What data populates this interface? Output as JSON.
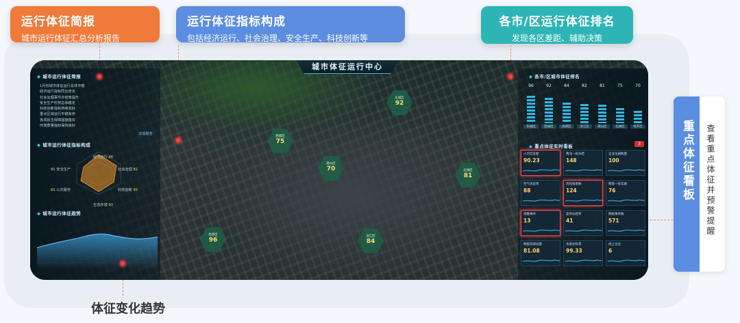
{
  "callouts": {
    "report": {
      "title": "运行体征简报",
      "subtitle": "城市运行体征汇总分析报告"
    },
    "composition": {
      "title": "运行体征指标构成",
      "subtitle": "包括经济运行、社会治理、安全生产、科技创新等"
    },
    "ranking": {
      "title": "各市/区运行体征排名",
      "subtitle": "发现各区差距、辅助决策"
    },
    "board": {
      "title": "重点体征看板",
      "subtitle": "查看重点体征并预警提醒"
    },
    "trend": {
      "title": "体征变化趋势"
    }
  },
  "dashboard": {
    "title": "城市体征运行中心",
    "left": {
      "brief_title": "城市运行体征简报",
      "brief_lines": [
        "1月份城市体征运行总体平稳",
        "经济运行指标同比增长",
        "社会治理事件办结率提升",
        "安全生产形势总体稳定",
        "科技创新指标持续向好",
        "重点区域运行平稳有序",
        "各项民生保障措施落实",
        "环境质量指标保持良好"
      ],
      "brief_more": "详情报告",
      "composition_title": "城市运行体征指标构成",
      "composition": [
        {
          "label": "经济运行",
          "value": "86"
        },
        {
          "label": "社会治理",
          "value": "82"
        },
        {
          "label": "安全生产",
          "value": "91"
        },
        {
          "label": "公共服务",
          "value": "81"
        },
        {
          "label": "科技创新",
          "value": "95"
        },
        {
          "label": "生态环境",
          "value": "93"
        }
      ],
      "trend_title": "城市运行体征趋势"
    },
    "map_labels": [
      {
        "name": "东城区",
        "value": "92"
      },
      {
        "name": "西城区",
        "value": "75"
      },
      {
        "name": "南山区",
        "value": "70"
      },
      {
        "name": "北湖区",
        "value": "81"
      },
      {
        "name": "高新区",
        "value": "96"
      },
      {
        "name": "滨江区",
        "value": "84"
      }
    ],
    "right": {
      "ranking_title": "各市/区城市体征排名",
      "ranking": [
        {
          "name": "东城区",
          "value": 96
        },
        {
          "name": "西城区",
          "value": 92
        },
        {
          "name": "高新区",
          "value": 84
        },
        {
          "name": "滨江区",
          "value": 82
        },
        {
          "name": "南山区",
          "value": 81
        },
        {
          "name": "北湖区",
          "value": 75
        },
        {
          "name": "经开区",
          "value": 70
        }
      ],
      "board_title": "重点体征实时看板",
      "alert_count": "3",
      "cards": [
        {
          "name": "人均可支配",
          "value": "90.23",
          "alert": true
        },
        {
          "name": "两违一拆办结",
          "value": "148",
          "alert": false
        },
        {
          "name": "企业注册数量",
          "value": "100",
          "alert": false
        },
        {
          "name": "空气优良率",
          "value": "88",
          "alert": false
        },
        {
          "name": "风险隐患数",
          "value": "124",
          "alert": true
        },
        {
          "name": "两客一危车辆",
          "value": "76",
          "alert": false
        },
        {
          "name": "预警事件",
          "value": "13",
          "alert": true
        },
        {
          "name": "案件办结率",
          "value": "41",
          "alert": false
        },
        {
          "name": "网格事件数",
          "value": "571",
          "alert": false
        },
        {
          "name": "数据资源总量",
          "value": "81.08",
          "alert": false
        },
        {
          "name": "水质达标率",
          "value": "99.33",
          "alert": false
        },
        {
          "name": "规上企业",
          "value": "6",
          "alert": false
        }
      ]
    }
  },
  "colors": {
    "orange": "#f07a3a",
    "blue": "#5b8de0",
    "teal": "#2db5b5",
    "alert": "#ff4a4a"
  }
}
